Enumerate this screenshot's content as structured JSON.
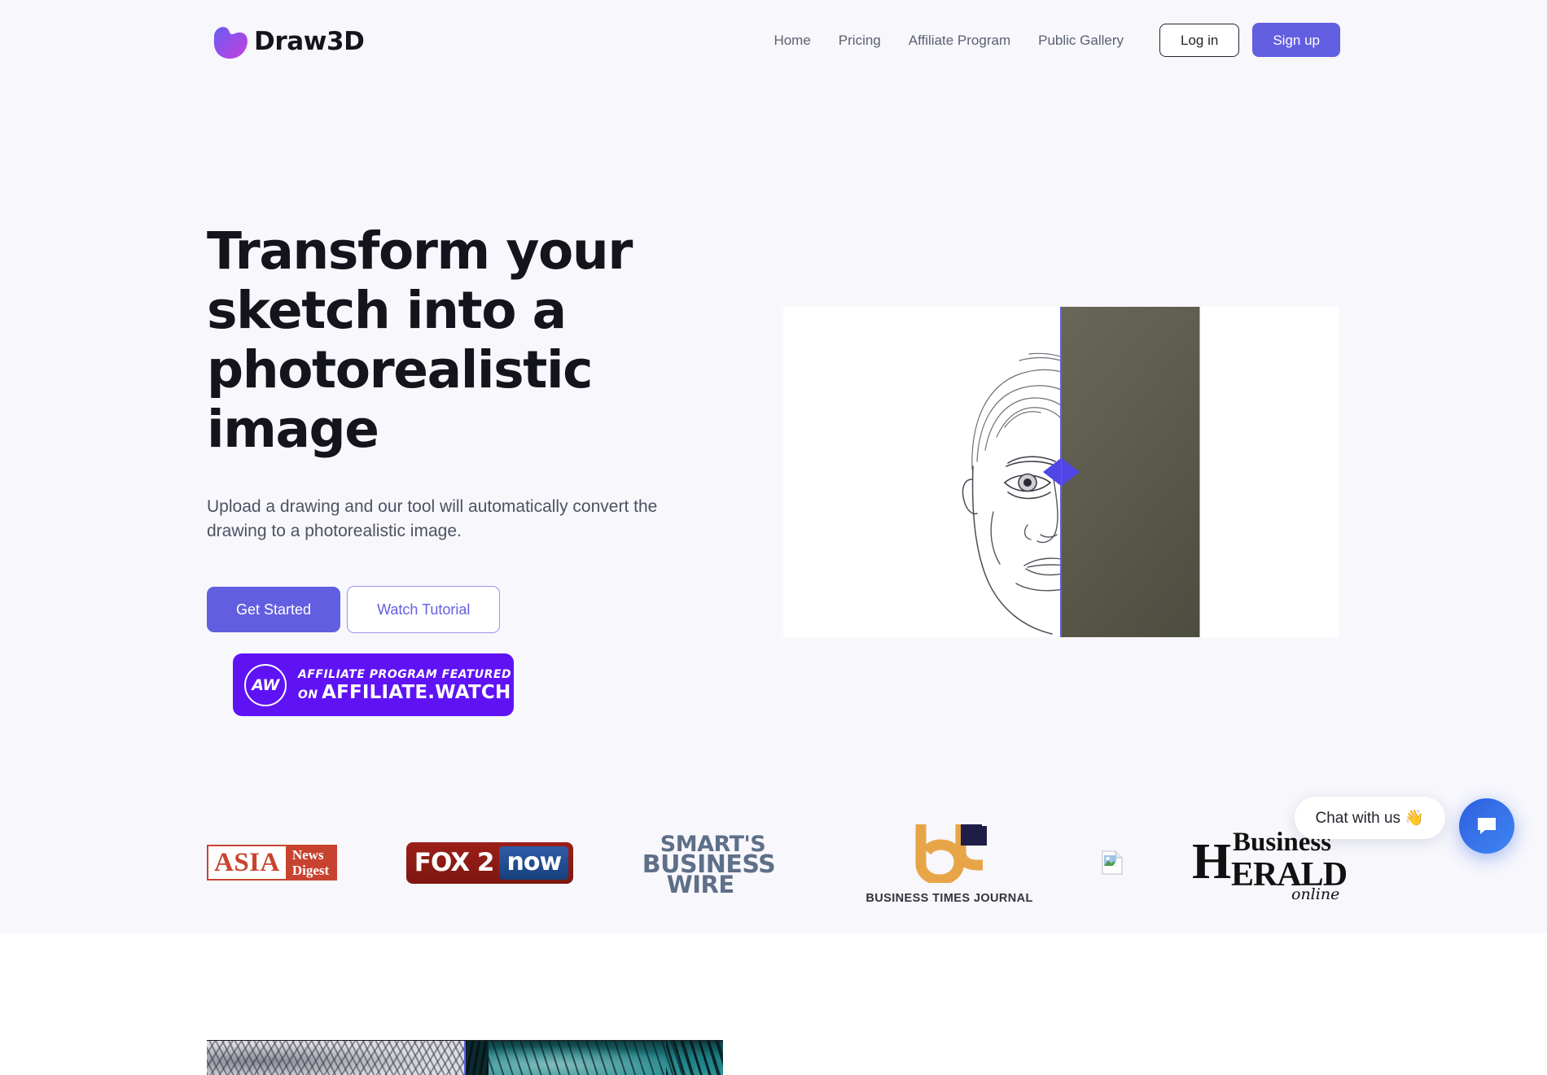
{
  "brand": {
    "name": "Draw3D",
    "logo_gradient_from": "#6a5cf0",
    "logo_gradient_to": "#c63fdf"
  },
  "nav": {
    "links": [
      {
        "label": "Home"
      },
      {
        "label": "Pricing"
      },
      {
        "label": "Affiliate Program"
      },
      {
        "label": "Public Gallery"
      }
    ],
    "login_label": "Log in",
    "signup_label": "Sign up",
    "signup_color": "#625ee0"
  },
  "hero": {
    "title": "Transform your sketch into a photorealistic image",
    "subtitle": "Upload a drawing and our tool will automatically convert the drawing to a photorealistic image.",
    "primary_cta": "Get Started",
    "secondary_cta": "Watch Tutorial",
    "primary_color": "#625ee0",
    "background_color": "#f7f7fc",
    "compare": {
      "before_alt": "Pencil sketch of a young man's face",
      "after_alt": "Photorealistic portrait of a young man",
      "handle_color": "#4f46e5",
      "position_percent": 50
    }
  },
  "affiliate_badge": {
    "mark": "AW",
    "line1": "AFFILIATE PROGRAM FEATURED ON",
    "line2": "AFFILIATE.WATCH",
    "background_color": "#5f13f5"
  },
  "press": {
    "logos": [
      {
        "name": "Asia News Digest",
        "word": "ASIA",
        "sub1": "News",
        "sub2": "Digest",
        "color": "#c8432f"
      },
      {
        "name": "FOX 2 now",
        "word": "FOX 2",
        "sub1": "now",
        "color_primary": "#8f1c15",
        "color_secondary": "#20539a"
      },
      {
        "name": "Smart's Business Wire",
        "line1": "SMART'S",
        "line2": "BUSINESS",
        "line3": "WIRE",
        "color": "#5e6f88"
      },
      {
        "name": "Business Times Journal",
        "word": "bt",
        "caption": "BUSINESS TIMES JOURNAL",
        "color": "#e9a council"
      },
      {
        "name": "broken-image-placeholder",
        "word": ""
      },
      {
        "name": "Business Herald online",
        "h": "H",
        "business": "Business",
        "erald": "ERALD",
        "online": "online"
      }
    ]
  },
  "bottom_preview": {
    "before_alt": "Pencil sketch of bare trees",
    "after_alt": "Teal sky photograph with bare trees",
    "handle_color": "#625ee0"
  },
  "chat": {
    "pill_label": "Chat with us 👋",
    "fab_icon": "chat-bubble-icon",
    "fab_color": "#2f5fe0"
  }
}
